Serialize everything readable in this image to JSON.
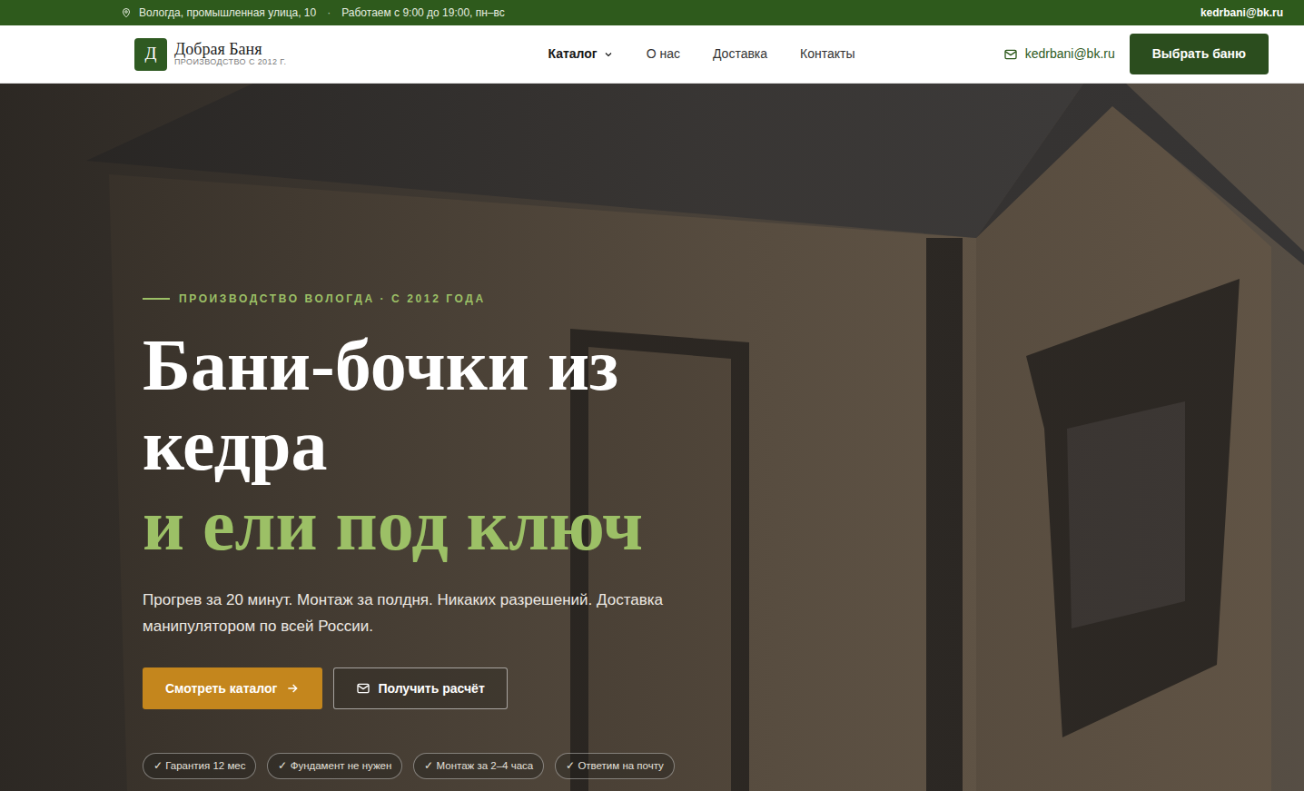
{
  "topbar": {
    "address": "Вологда, промышленная улица, 10",
    "separator": "·",
    "hours": "Работаем с 9:00 до 19:00, пн–вс",
    "email": "kedrbani@bk.ru"
  },
  "navbar": {
    "logo_letter": "Д",
    "brand": "Добрая Баня",
    "tagline": "ПРОИЗВОДСТВО С 2012 Г.",
    "menu": [
      {
        "label": "Каталог",
        "dropdown": true,
        "selected": true
      },
      {
        "label": "О нас",
        "dropdown": false,
        "selected": false
      },
      {
        "label": "Доставка",
        "dropdown": false,
        "selected": false
      },
      {
        "label": "Контакты",
        "dropdown": false,
        "selected": false
      }
    ],
    "email": "kedrbani@bk.ru",
    "cta": "Выбрать баню"
  },
  "hero": {
    "eyebrow": "ПРОИЗВОДСТВО ВОЛОГДА · С 2012 ГОДА",
    "title": "Бани-бочки из кедра",
    "title_accent": "и ели под ключ",
    "lead": "Прогрев за 20 минут. Монтаж за полдня. Никаких разрешений. Доставка манипулятором по всей России.",
    "buttons": [
      {
        "label": "Смотреть каталог",
        "kind": "primary"
      },
      {
        "label": "Получить расчёт",
        "kind": "outline"
      }
    ],
    "badges": [
      "✓ Гарантия 12 мес",
      "✓ Фундамент не нужен",
      "✓ Монтаж за 2–4 часа",
      "✓ Ответим на почту"
    ]
  }
}
